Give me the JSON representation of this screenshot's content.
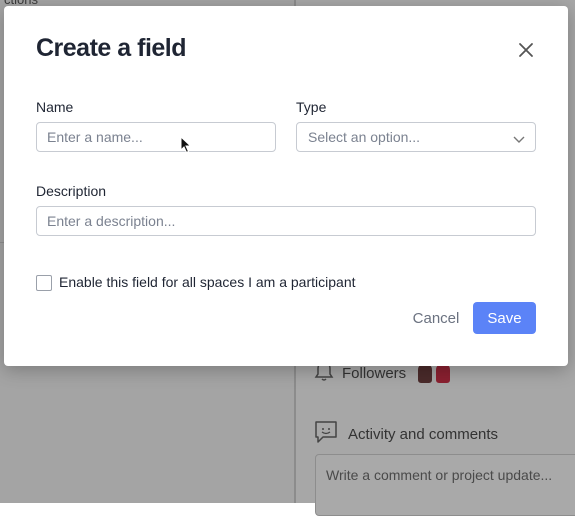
{
  "modal": {
    "title": "Create a field",
    "name_label": "Name",
    "name_placeholder": "Enter a name...",
    "type_label": "Type",
    "type_placeholder": "Select an option...",
    "description_label": "Description",
    "description_placeholder": "Enter a description...",
    "checkbox_label": "Enable this field for all spaces I am a participant",
    "checkbox_checked": false,
    "cancel_label": "Cancel",
    "save_label": "Save"
  },
  "background": {
    "top_fragment": "ctions",
    "followers_label": "Followers",
    "activity_label": "Activity and comments",
    "comment_placeholder": "Write a comment or project update..."
  },
  "colors": {
    "primary": "#5b83f7",
    "overlay": "#a3a3a3"
  }
}
